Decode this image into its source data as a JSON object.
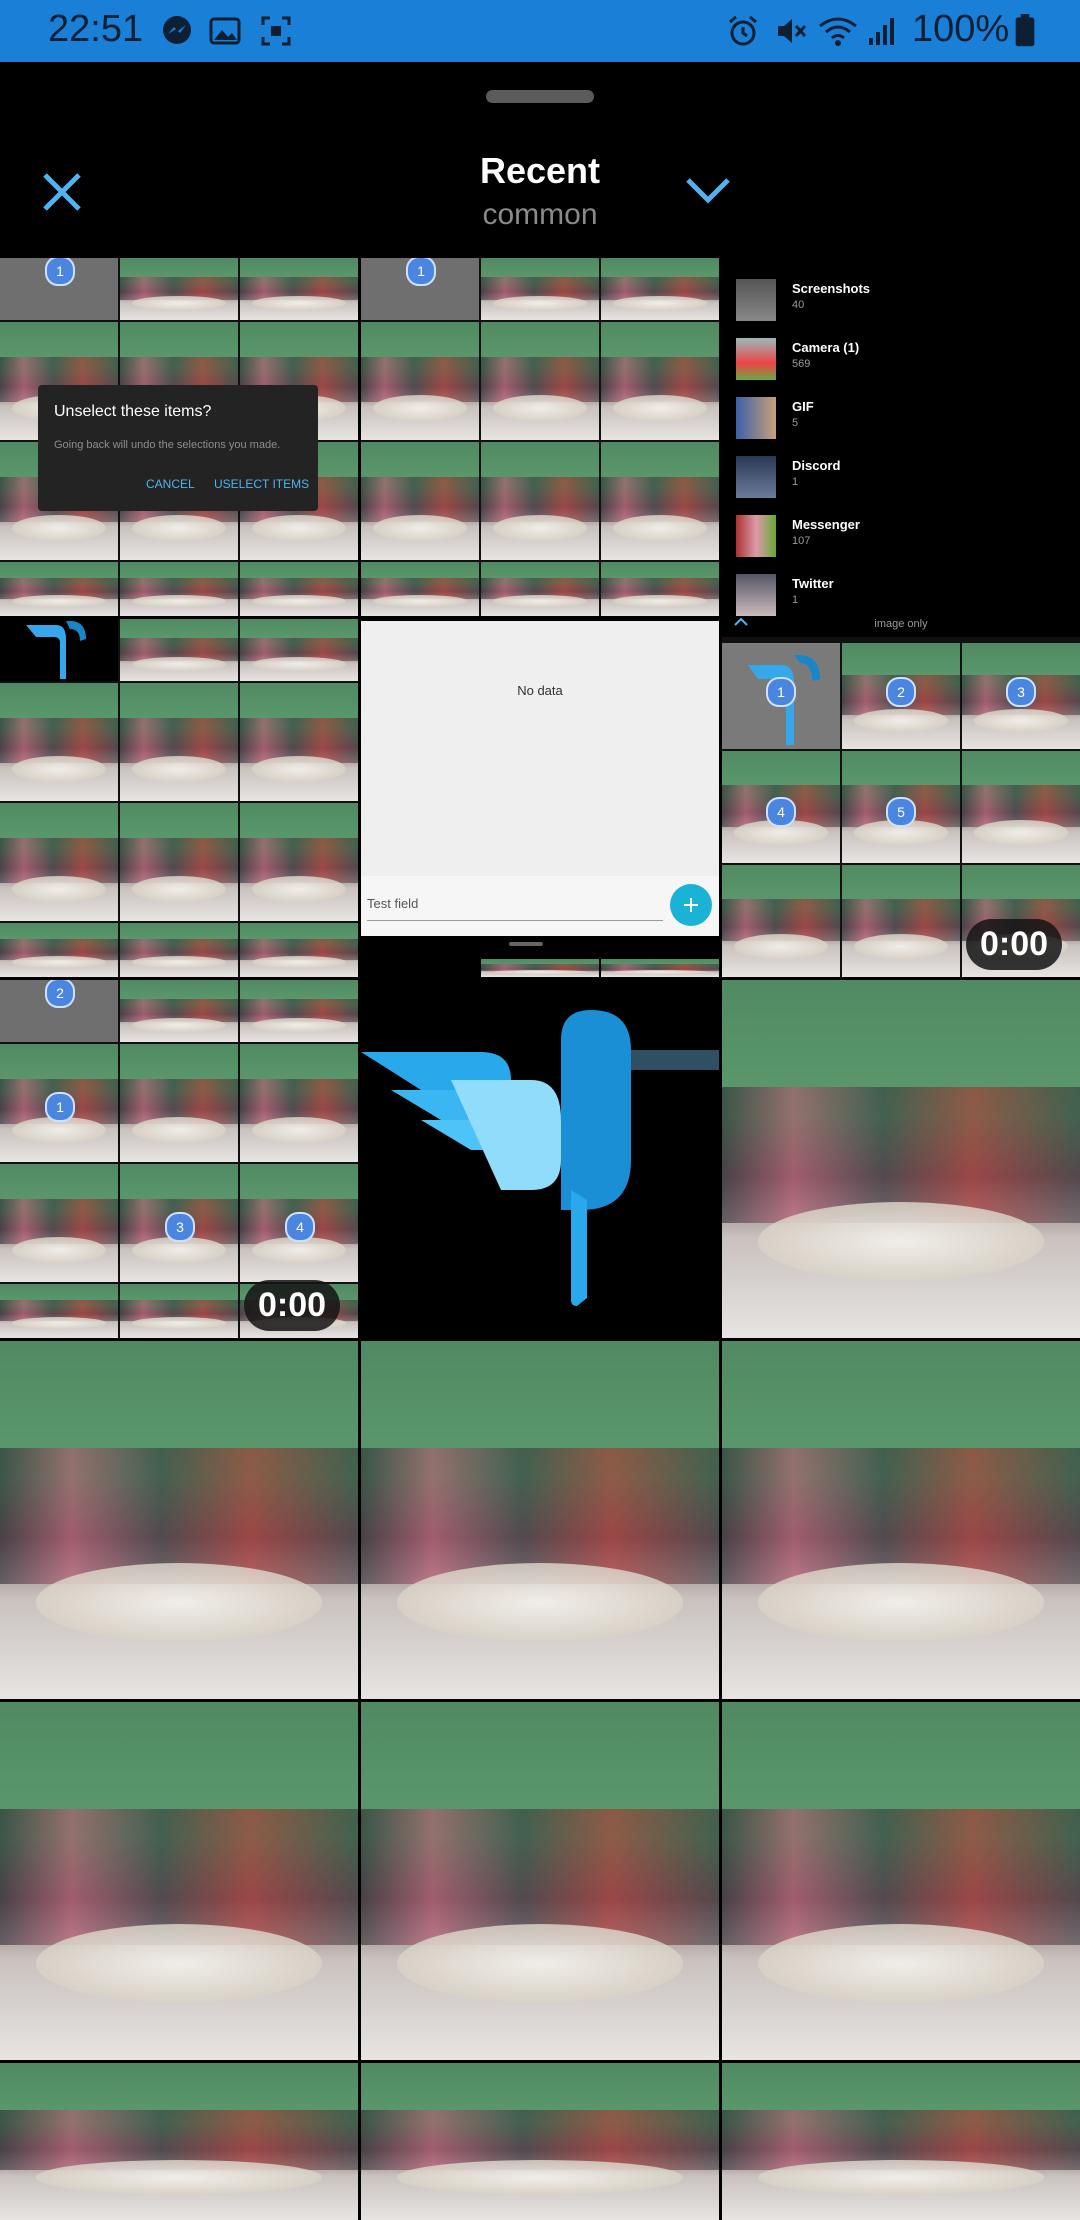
{
  "status_bar": {
    "time": "22:51",
    "battery": "100%",
    "left_icons": [
      "messenger-icon",
      "gallery-icon",
      "screenshot-icon"
    ],
    "right_icons": [
      "alarm-icon",
      "mute-icon",
      "wifi-icon",
      "signal-icon",
      "battery-icon"
    ]
  },
  "header": {
    "title": "Recent",
    "subtitle": "common",
    "close_icon": "close-icon",
    "dropdown_icon": "chevron-down-icon"
  },
  "dialog": {
    "title": "Unselect these items?",
    "message": "Going back will undo the selections you made.",
    "cancel_label": "CANCEL",
    "confirm_label": "USELECT ITEMS"
  },
  "folders": [
    {
      "name": "Screenshots",
      "count": "40"
    },
    {
      "name": "Camera (1)",
      "count": "569"
    },
    {
      "name": "GIF",
      "count": "5"
    },
    {
      "name": "Discord",
      "count": "1"
    },
    {
      "name": "Messenger",
      "count": "107"
    },
    {
      "name": "Twitter",
      "count": "1"
    }
  ],
  "folder_footer": "image only",
  "empty_state": {
    "message": "No data",
    "input_placeholder": "Test field",
    "add_icon": "plus-icon"
  },
  "badges_row2": [
    "1",
    "2",
    "3",
    "4",
    "5"
  ],
  "badges_row3": [
    "2",
    "1",
    "3",
    "4"
  ],
  "badge_row1": [
    "1",
    "1"
  ],
  "durations": [
    "0:00",
    "0:00"
  ],
  "colors": {
    "status_bar": "#1a7fd6",
    "accent": "#4fb3f0",
    "fab": "#1ab3d6",
    "badge": "#4a86e0"
  }
}
